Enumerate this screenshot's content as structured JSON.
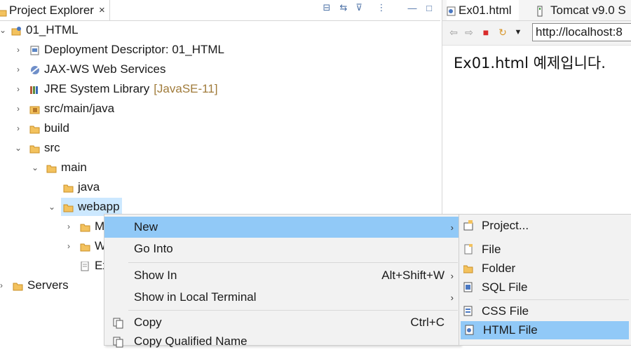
{
  "explorer": {
    "tab_title": "Project Explorer",
    "close_glyph": "×",
    "toolbar": [
      {
        "name": "collapse-all-icon",
        "glyph": "⊟"
      },
      {
        "name": "link-with-editor-icon",
        "glyph": "⇆"
      },
      {
        "name": "filter-icon",
        "glyph": "⊽"
      },
      {
        "name": "view-menu-icon",
        "glyph": "⋮"
      },
      {
        "name": "minimize-icon",
        "glyph": "—"
      },
      {
        "name": "maximize-icon",
        "glyph": "□"
      }
    ],
    "tree": [
      {
        "label": "01_HTML",
        "depth": 0
      },
      {
        "label": "Deployment Descriptor: 01_HTML",
        "depth": 1
      },
      {
        "label": "JAX-WS Web Services",
        "depth": 1
      },
      {
        "label": "JRE System Library",
        "decoration": "[JavaSE-11]",
        "depth": 1
      },
      {
        "label": "src/main/java",
        "depth": 1
      },
      {
        "label": "build",
        "depth": 1
      },
      {
        "label": "src",
        "depth": 1
      },
      {
        "label": "main",
        "depth": 2
      },
      {
        "label": "java",
        "depth": 3
      },
      {
        "label": "webapp",
        "depth": 3
      },
      {
        "label": "M",
        "depth": 4
      },
      {
        "label": "W",
        "depth": 4
      },
      {
        "label": "Ex",
        "depth": 4
      },
      {
        "label": "Servers",
        "depth": 0
      }
    ]
  },
  "browser": {
    "tabs": [
      {
        "label": "Ex01.html"
      },
      {
        "label": "Tomcat v9.0 S"
      }
    ],
    "url": "http://localhost:8",
    "content_text": "Ex01.html 예제입니다."
  },
  "context_menu": {
    "items": [
      {
        "label": "New",
        "accel": "",
        "submenu": true
      },
      {
        "label": "Go Into",
        "accel": "",
        "submenu": false
      },
      {
        "label": "Show In",
        "accel": "Alt+Shift+W",
        "submenu": true
      },
      {
        "label": "Show in Local Terminal",
        "accel": "",
        "submenu": true
      },
      {
        "label": "Copy",
        "accel": "Ctrl+C",
        "submenu": false
      },
      {
        "label": "Copy Qualified Name",
        "accel": "",
        "submenu": false
      }
    ],
    "submenu_glyph": "›"
  },
  "submenu": {
    "items": [
      {
        "label": "Project...",
        "icon": "project-icon"
      },
      {
        "label": "File",
        "icon": "file-icon"
      },
      {
        "label": "Folder",
        "icon": "folder-icon"
      },
      {
        "label": "SQL File",
        "icon": "sql-file-icon"
      },
      {
        "label": "CSS File",
        "icon": "css-file-icon"
      },
      {
        "label": "HTML File",
        "icon": "html-file-icon"
      }
    ]
  },
  "colors": {
    "selection": "#cce8ff",
    "menu_highlight": "#91c9f7",
    "folder": "#f3c25e"
  }
}
